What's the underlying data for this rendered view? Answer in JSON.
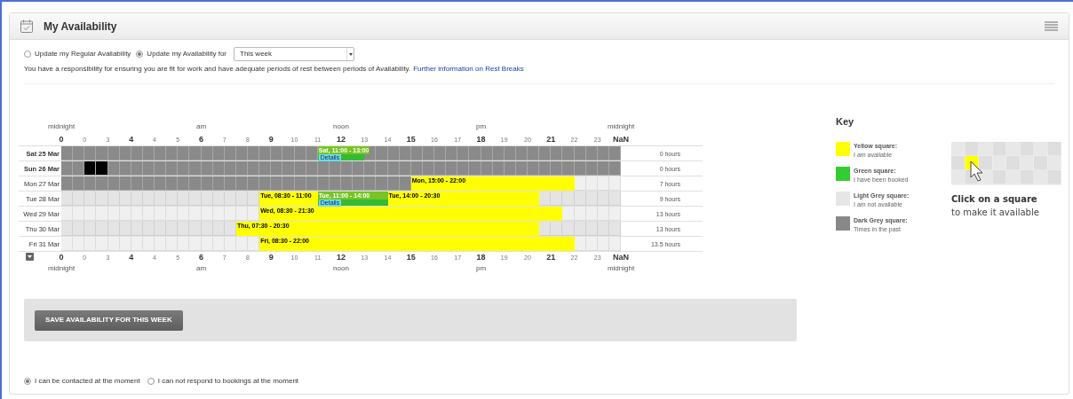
{
  "panel": {
    "title": "My Availability"
  },
  "mode_options": [
    {
      "label": "Update my Regular Availability",
      "selected": false
    },
    {
      "label": "Update my Availability for",
      "selected": true
    }
  ],
  "period_select": {
    "value": "This week"
  },
  "notice": {
    "text": "You have a responsibility for ensuring you are fit for work and have adequate periods of rest between periods of Availability.",
    "link": "Further information on Rest Breaks"
  },
  "timeline": {
    "axis_top": {
      "periods": [
        "midnight",
        "am",
        "noon",
        "pm",
        "midnight"
      ],
      "ticks": [
        {
          "label": "0",
          "major": true
        },
        {
          "label": "0",
          "major": false
        },
        {
          "label": "3",
          "major": false
        },
        {
          "label": "4",
          "major": true
        },
        {
          "label": "4",
          "major": false
        },
        {
          "label": "5",
          "major": false
        },
        {
          "label": "6",
          "major": true
        },
        {
          "label": "7",
          "major": false
        },
        {
          "label": "8",
          "major": false
        },
        {
          "label": "9",
          "major": true
        },
        {
          "label": "10",
          "major": false
        },
        {
          "label": "11",
          "major": false
        },
        {
          "label": "12",
          "major": true
        },
        {
          "label": "13",
          "major": false
        },
        {
          "label": "14",
          "major": false
        },
        {
          "label": "15",
          "major": true
        },
        {
          "label": "16",
          "major": false
        },
        {
          "label": "17",
          "major": false
        },
        {
          "label": "18",
          "major": true
        },
        {
          "label": "19",
          "major": false
        },
        {
          "label": "20",
          "major": false
        },
        {
          "label": "21",
          "major": true
        },
        {
          "label": "22",
          "major": false
        },
        {
          "label": "23",
          "major": false
        },
        {
          "label": "NaN",
          "major": true
        }
      ]
    },
    "axis_bottom": {
      "periods": [
        "midnight",
        "am",
        "noon",
        "pm",
        "midnight"
      ],
      "ticks": [
        {
          "label": "0",
          "major": true
        },
        {
          "label": "0",
          "major": false
        },
        {
          "label": "3",
          "major": false
        },
        {
          "label": "4",
          "major": true
        },
        {
          "label": "4",
          "major": false
        },
        {
          "label": "5",
          "major": false
        },
        {
          "label": "6",
          "major": true
        },
        {
          "label": "7",
          "major": false
        },
        {
          "label": "8",
          "major": false
        },
        {
          "label": "9",
          "major": true
        },
        {
          "label": "10",
          "major": false
        },
        {
          "label": "11",
          "major": false
        },
        {
          "label": "12",
          "major": true
        },
        {
          "label": "13",
          "major": false
        },
        {
          "label": "14",
          "major": false
        },
        {
          "label": "15",
          "major": true
        },
        {
          "label": "16",
          "major": false
        },
        {
          "label": "17",
          "major": false
        },
        {
          "label": "18",
          "major": true
        },
        {
          "label": "19",
          "major": false
        },
        {
          "label": "20",
          "major": false
        },
        {
          "label": "21",
          "major": true
        },
        {
          "label": "22",
          "major": false
        },
        {
          "label": "23",
          "major": false
        },
        {
          "label": "NaN",
          "major": true
        }
      ]
    },
    "rows": [
      {
        "date": "Sat 25 Mar",
        "bold": true,
        "total": "0 hours",
        "cells": [
          {
            "kind": "past"
          },
          {
            "kind": "past"
          },
          {
            "kind": "past"
          },
          {
            "kind": "past"
          },
          {
            "kind": "past"
          },
          {
            "kind": "past"
          },
          {
            "kind": "past"
          },
          {
            "kind": "past"
          },
          {
            "kind": "past"
          },
          {
            "kind": "past"
          },
          {
            "kind": "past"
          },
          {
            "kind": "past"
          },
          {
            "kind": "past"
          },
          {
            "kind": "past"
          },
          {
            "kind": "past"
          },
          {
            "kind": "past"
          },
          {
            "kind": "past"
          },
          {
            "kind": "past"
          },
          {
            "kind": "past"
          },
          {
            "kind": "past"
          },
          {
            "kind": "past"
          },
          {
            "kind": "past"
          },
          {
            "kind": "booked"
          },
          {
            "kind": "booked"
          },
          {
            "kind": "booked"
          },
          {
            "kind": "booked"
          },
          {
            "kind": "past"
          },
          {
            "kind": "past"
          },
          {
            "kind": "past"
          },
          {
            "kind": "past"
          },
          {
            "kind": "past"
          },
          {
            "kind": "past"
          },
          {
            "kind": "past"
          },
          {
            "kind": "past"
          },
          {
            "kind": "past"
          },
          {
            "kind": "past"
          },
          {
            "kind": "past"
          },
          {
            "kind": "past"
          },
          {
            "kind": "past"
          },
          {
            "kind": "past"
          },
          {
            "kind": "past"
          },
          {
            "kind": "past"
          },
          {
            "kind": "past"
          },
          {
            "kind": "past"
          },
          {
            "kind": "past"
          },
          {
            "kind": "past"
          },
          {
            "kind": "past"
          },
          {
            "kind": "past"
          }
        ],
        "blocks": [
          {
            "text": "Sat, 11:00 - 13:00",
            "details": "Details"
          }
        ]
      },
      {
        "date": "Sun 26 Mar",
        "bold": true,
        "total": "0 hours",
        "cells": [
          {
            "kind": "past"
          },
          {
            "kind": "past"
          },
          {
            "kind": "void"
          },
          {
            "kind": "void"
          },
          {
            "kind": "past"
          },
          {
            "kind": "past"
          },
          {
            "kind": "past"
          },
          {
            "kind": "past"
          },
          {
            "kind": "past"
          },
          {
            "kind": "past"
          },
          {
            "kind": "past"
          },
          {
            "kind": "past"
          },
          {
            "kind": "past"
          },
          {
            "kind": "past"
          },
          {
            "kind": "past"
          },
          {
            "kind": "past"
          },
          {
            "kind": "past"
          },
          {
            "kind": "past"
          },
          {
            "kind": "past"
          },
          {
            "kind": "past"
          },
          {
            "kind": "past"
          },
          {
            "kind": "past"
          },
          {
            "kind": "past"
          },
          {
            "kind": "past"
          },
          {
            "kind": "past"
          },
          {
            "kind": "past"
          },
          {
            "kind": "past"
          },
          {
            "kind": "past"
          },
          {
            "kind": "past"
          },
          {
            "kind": "past"
          },
          {
            "kind": "past"
          },
          {
            "kind": "past"
          },
          {
            "kind": "past"
          },
          {
            "kind": "past"
          },
          {
            "kind": "past"
          },
          {
            "kind": "past"
          },
          {
            "kind": "past"
          },
          {
            "kind": "past"
          },
          {
            "kind": "past"
          },
          {
            "kind": "past"
          },
          {
            "kind": "past"
          },
          {
            "kind": "past"
          },
          {
            "kind": "past"
          },
          {
            "kind": "past"
          },
          {
            "kind": "past"
          },
          {
            "kind": "past"
          },
          {
            "kind": "past"
          },
          {
            "kind": "past"
          }
        ],
        "blocks": []
      },
      {
        "date": "Mon 27 Mar",
        "bold": false,
        "total": "7 hours",
        "cells": [
          {
            "kind": "past"
          },
          {
            "kind": "past"
          },
          {
            "kind": "past"
          },
          {
            "kind": "past"
          },
          {
            "kind": "past"
          },
          {
            "kind": "past"
          },
          {
            "kind": "past"
          },
          {
            "kind": "past"
          },
          {
            "kind": "past"
          },
          {
            "kind": "past"
          },
          {
            "kind": "past"
          },
          {
            "kind": "past"
          },
          {
            "kind": "past"
          },
          {
            "kind": "past"
          },
          {
            "kind": "past"
          },
          {
            "kind": "past"
          },
          {
            "kind": "past"
          },
          {
            "kind": "past"
          },
          {
            "kind": "past"
          },
          {
            "kind": "past"
          },
          {
            "kind": "past"
          },
          {
            "kind": "past"
          },
          {
            "kind": "past"
          },
          {
            "kind": "past"
          },
          {
            "kind": "past"
          },
          {
            "kind": "past"
          },
          {
            "kind": "past"
          },
          {
            "kind": "past"
          },
          {
            "kind": "past"
          },
          {
            "kind": "past"
          },
          {
            "kind": "available"
          },
          {
            "kind": "available"
          },
          {
            "kind": "available"
          },
          {
            "kind": "available"
          },
          {
            "kind": "available"
          },
          {
            "kind": "available"
          },
          {
            "kind": "available"
          },
          {
            "kind": "available"
          },
          {
            "kind": "available"
          },
          {
            "kind": "available"
          },
          {
            "kind": "available"
          },
          {
            "kind": "available"
          },
          {
            "kind": "available"
          },
          {
            "kind": "available"
          },
          {
            "kind": "unavailable"
          },
          {
            "kind": "unavailable"
          },
          {
            "kind": "unavailable"
          },
          {
            "kind": "unavailable"
          }
        ],
        "blocks": [
          {
            "text": "Mon, 15:00 - 22:00"
          }
        ]
      },
      {
        "date": "Tue 28 Mar",
        "bold": false,
        "total": "9 hours",
        "cells": [
          {
            "kind": "unavailable"
          },
          {
            "kind": "unavailable"
          },
          {
            "kind": "unavailable"
          },
          {
            "kind": "unavailable"
          },
          {
            "kind": "unavailable"
          },
          {
            "kind": "unavailable"
          },
          {
            "kind": "unavailable"
          },
          {
            "kind": "unavailable"
          },
          {
            "kind": "unavailable"
          },
          {
            "kind": "unavailable"
          },
          {
            "kind": "unavailable"
          },
          {
            "kind": "unavailable"
          },
          {
            "kind": "unavailable"
          },
          {
            "kind": "unavailable"
          },
          {
            "kind": "unavailable"
          },
          {
            "kind": "unavailable"
          },
          {
            "kind": "unavailable"
          },
          {
            "kind": "available"
          },
          {
            "kind": "available"
          },
          {
            "kind": "available"
          },
          {
            "kind": "available"
          },
          {
            "kind": "available"
          },
          {
            "kind": "booked"
          },
          {
            "kind": "booked"
          },
          {
            "kind": "booked"
          },
          {
            "kind": "booked"
          },
          {
            "kind": "booked"
          },
          {
            "kind": "booked"
          },
          {
            "kind": "available"
          },
          {
            "kind": "available"
          },
          {
            "kind": "available"
          },
          {
            "kind": "available"
          },
          {
            "kind": "available"
          },
          {
            "kind": "available"
          },
          {
            "kind": "available"
          },
          {
            "kind": "available"
          },
          {
            "kind": "available"
          },
          {
            "kind": "available"
          },
          {
            "kind": "available"
          },
          {
            "kind": "available"
          },
          {
            "kind": "available"
          },
          {
            "kind": "unavailable"
          },
          {
            "kind": "unavailable"
          },
          {
            "kind": "unavailable"
          },
          {
            "kind": "unavailable"
          },
          {
            "kind": "unavailable"
          },
          {
            "kind": "unavailable"
          },
          {
            "kind": "unavailable"
          }
        ],
        "blocks": [
          {
            "text": "Tue, 08:30 - 11:00"
          },
          {
            "text": "Tue, 11:00 - 14:00",
            "details": "Details"
          },
          {
            "text": "Tue, 14:00 - 20:30"
          }
        ]
      },
      {
        "date": "Wed 29 Mar",
        "bold": false,
        "total": "13 hours",
        "cells": [
          {
            "kind": "unavailable"
          },
          {
            "kind": "unavailable"
          },
          {
            "kind": "unavailable"
          },
          {
            "kind": "unavailable"
          },
          {
            "kind": "unavailable"
          },
          {
            "kind": "unavailable"
          },
          {
            "kind": "unavailable"
          },
          {
            "kind": "unavailable"
          },
          {
            "kind": "unavailable"
          },
          {
            "kind": "unavailable"
          },
          {
            "kind": "unavailable"
          },
          {
            "kind": "unavailable"
          },
          {
            "kind": "unavailable"
          },
          {
            "kind": "unavailable"
          },
          {
            "kind": "unavailable"
          },
          {
            "kind": "unavailable"
          },
          {
            "kind": "unavailable"
          },
          {
            "kind": "available"
          },
          {
            "kind": "available"
          },
          {
            "kind": "available"
          },
          {
            "kind": "available"
          },
          {
            "kind": "available"
          },
          {
            "kind": "available"
          },
          {
            "kind": "available"
          },
          {
            "kind": "available"
          },
          {
            "kind": "available"
          },
          {
            "kind": "available"
          },
          {
            "kind": "available"
          },
          {
            "kind": "available"
          },
          {
            "kind": "available"
          },
          {
            "kind": "available"
          },
          {
            "kind": "available"
          },
          {
            "kind": "available"
          },
          {
            "kind": "available"
          },
          {
            "kind": "available"
          },
          {
            "kind": "available"
          },
          {
            "kind": "available"
          },
          {
            "kind": "available"
          },
          {
            "kind": "available"
          },
          {
            "kind": "available"
          },
          {
            "kind": "available"
          },
          {
            "kind": "available"
          },
          {
            "kind": "available"
          },
          {
            "kind": "unavailable"
          },
          {
            "kind": "unavailable"
          },
          {
            "kind": "unavailable"
          },
          {
            "kind": "unavailable"
          },
          {
            "kind": "unavailable"
          }
        ],
        "blocks": [
          {
            "text": "Wed, 08:30 - 21:30"
          }
        ]
      },
      {
        "date": "Thu 30 Mar",
        "bold": false,
        "total": "13 hours",
        "cells": [
          {
            "kind": "unavailable"
          },
          {
            "kind": "unavailable"
          },
          {
            "kind": "unavailable"
          },
          {
            "kind": "unavailable"
          },
          {
            "kind": "unavailable"
          },
          {
            "kind": "unavailable"
          },
          {
            "kind": "unavailable"
          },
          {
            "kind": "unavailable"
          },
          {
            "kind": "unavailable"
          },
          {
            "kind": "unavailable"
          },
          {
            "kind": "unavailable"
          },
          {
            "kind": "unavailable"
          },
          {
            "kind": "unavailable"
          },
          {
            "kind": "unavailable"
          },
          {
            "kind": "unavailable"
          },
          {
            "kind": "available"
          },
          {
            "kind": "available"
          },
          {
            "kind": "available"
          },
          {
            "kind": "available"
          },
          {
            "kind": "available"
          },
          {
            "kind": "available"
          },
          {
            "kind": "available"
          },
          {
            "kind": "available"
          },
          {
            "kind": "available"
          },
          {
            "kind": "available"
          },
          {
            "kind": "available"
          },
          {
            "kind": "available"
          },
          {
            "kind": "available"
          },
          {
            "kind": "available"
          },
          {
            "kind": "available"
          },
          {
            "kind": "available"
          },
          {
            "kind": "available"
          },
          {
            "kind": "available"
          },
          {
            "kind": "available"
          },
          {
            "kind": "available"
          },
          {
            "kind": "available"
          },
          {
            "kind": "available"
          },
          {
            "kind": "available"
          },
          {
            "kind": "available"
          },
          {
            "kind": "available"
          },
          {
            "kind": "available"
          },
          {
            "kind": "unavailable"
          },
          {
            "kind": "unavailable"
          },
          {
            "kind": "unavailable"
          },
          {
            "kind": "unavailable"
          },
          {
            "kind": "unavailable"
          },
          {
            "kind": "unavailable"
          },
          {
            "kind": "unavailable"
          }
        ],
        "blocks": [
          {
            "text": "Thu, 07:30 - 20:30"
          }
        ]
      },
      {
        "date": "Fri 31 Mar",
        "bold": false,
        "total": "13.5 hours",
        "cells": [
          {
            "kind": "unavailable"
          },
          {
            "kind": "unavailable"
          },
          {
            "kind": "unavailable"
          },
          {
            "kind": "unavailable"
          },
          {
            "kind": "unavailable"
          },
          {
            "kind": "unavailable"
          },
          {
            "kind": "unavailable"
          },
          {
            "kind": "unavailable"
          },
          {
            "kind": "unavailable"
          },
          {
            "kind": "unavailable"
          },
          {
            "kind": "unavailable"
          },
          {
            "kind": "unavailable"
          },
          {
            "kind": "unavailable"
          },
          {
            "kind": "unavailable"
          },
          {
            "kind": "unavailable"
          },
          {
            "kind": "unavailable"
          },
          {
            "kind": "unavailable"
          },
          {
            "kind": "available"
          },
          {
            "kind": "available"
          },
          {
            "kind": "available"
          },
          {
            "kind": "available"
          },
          {
            "kind": "available"
          },
          {
            "kind": "available"
          },
          {
            "kind": "available"
          },
          {
            "kind": "available"
          },
          {
            "kind": "available"
          },
          {
            "kind": "available"
          },
          {
            "kind": "available"
          },
          {
            "kind": "available"
          },
          {
            "kind": "available"
          },
          {
            "kind": "available"
          },
          {
            "kind": "available"
          },
          {
            "kind": "available"
          },
          {
            "kind": "available"
          },
          {
            "kind": "available"
          },
          {
            "kind": "available"
          },
          {
            "kind": "available"
          },
          {
            "kind": "available"
          },
          {
            "kind": "available"
          },
          {
            "kind": "available"
          },
          {
            "kind": "available"
          },
          {
            "kind": "available"
          },
          {
            "kind": "available"
          },
          {
            "kind": "available"
          },
          {
            "kind": "unavailable"
          },
          {
            "kind": "unavailable"
          },
          {
            "kind": "unavailable"
          },
          {
            "kind": "unavailable"
          }
        ],
        "blocks": [
          {
            "text": "Fri, 08:30 - 22:00"
          }
        ]
      }
    ]
  },
  "key": {
    "title": "Key",
    "items": [
      {
        "title": "Yellow square:",
        "description": "I am available",
        "color": "#ffff00"
      },
      {
        "title": "Green square:",
        "description": "I have been booked",
        "color": "#33cc33"
      },
      {
        "title": "Light Grey square:",
        "description": "I am not available",
        "color": "#e6e6e6"
      },
      {
        "title": "Dark Grey square:",
        "description": "Times in the past",
        "color": "#888888"
      }
    ],
    "hint_title": "Click on a square",
    "hint_text": "to make it available"
  },
  "save_button": {
    "label": "SAVE AVAILABILITY FOR THIS WEEK"
  },
  "contact_options": [
    {
      "label": "I can be contacted at the moment",
      "selected": true
    },
    {
      "label": "I can not respond to bookings at the moment",
      "selected": false
    }
  ]
}
